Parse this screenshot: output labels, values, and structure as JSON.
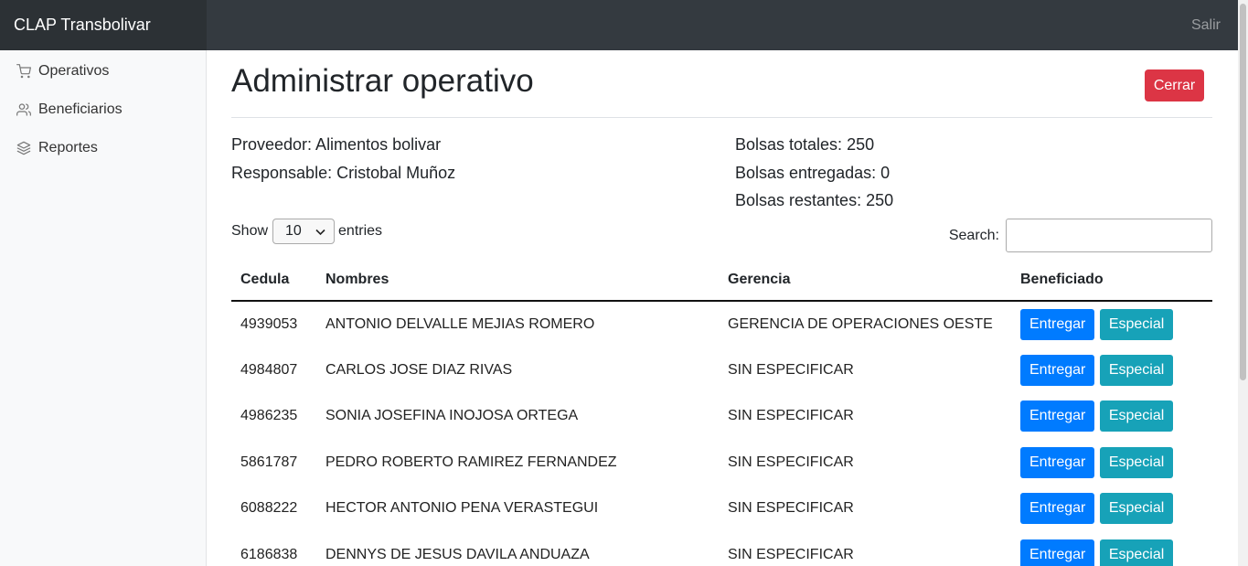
{
  "app": {
    "brand": "CLAP Transbolivar",
    "signout": "Salir"
  },
  "sidebar": {
    "items": [
      {
        "label": "Operativos",
        "icon": "cart-icon"
      },
      {
        "label": "Beneficiarios",
        "icon": "users-icon"
      },
      {
        "label": "Reportes",
        "icon": "layers-icon"
      }
    ]
  },
  "page": {
    "title": "Administrar operativo",
    "close_label": "Cerrar",
    "proveedor": "Proveedor: Alimentos bolivar",
    "responsable": "Responsable: Cristobal Muñoz",
    "bolsas_totales": "Bolsas totales: 250",
    "bolsas_entregadas": "Bolsas entregadas: 0",
    "bolsas_restantes": "Bolsas restantes: 250"
  },
  "table_controls": {
    "show_label": "Show",
    "entries_value": "10",
    "entries_label": "entries",
    "search_label": "Search:"
  },
  "table": {
    "headers": [
      "Cedula",
      "Nombres",
      "Gerencia",
      "Beneficiado"
    ],
    "entregar_label": "Entregar",
    "especial_label": "Especial",
    "rows": [
      {
        "cedula": "4939053",
        "nombres": "ANTONIO DELVALLE MEJIAS ROMERO",
        "gerencia": "GERENCIA DE OPERACIONES OESTE"
      },
      {
        "cedula": "4984807",
        "nombres": "CARLOS JOSE DIAZ RIVAS",
        "gerencia": "SIN ESPECIFICAR"
      },
      {
        "cedula": "4986235",
        "nombres": "SONIA JOSEFINA INOJOSA ORTEGA",
        "gerencia": "SIN ESPECIFICAR"
      },
      {
        "cedula": "5861787",
        "nombres": "PEDRO ROBERTO RAMIREZ FERNANDEZ",
        "gerencia": "SIN ESPECIFICAR"
      },
      {
        "cedula": "6088222",
        "nombres": "HECTOR ANTONIO PENA VERASTEGUI",
        "gerencia": "SIN ESPECIFICAR"
      },
      {
        "cedula": "6186838",
        "nombres": "DENNYS DE JESUS DAVILA ANDUAZA",
        "gerencia": "SIN ESPECIFICAR"
      }
    ]
  },
  "colors": {
    "danger": "#dc3545",
    "primary": "#007bff",
    "info": "#17a2b8",
    "navbar": "#343a40"
  }
}
